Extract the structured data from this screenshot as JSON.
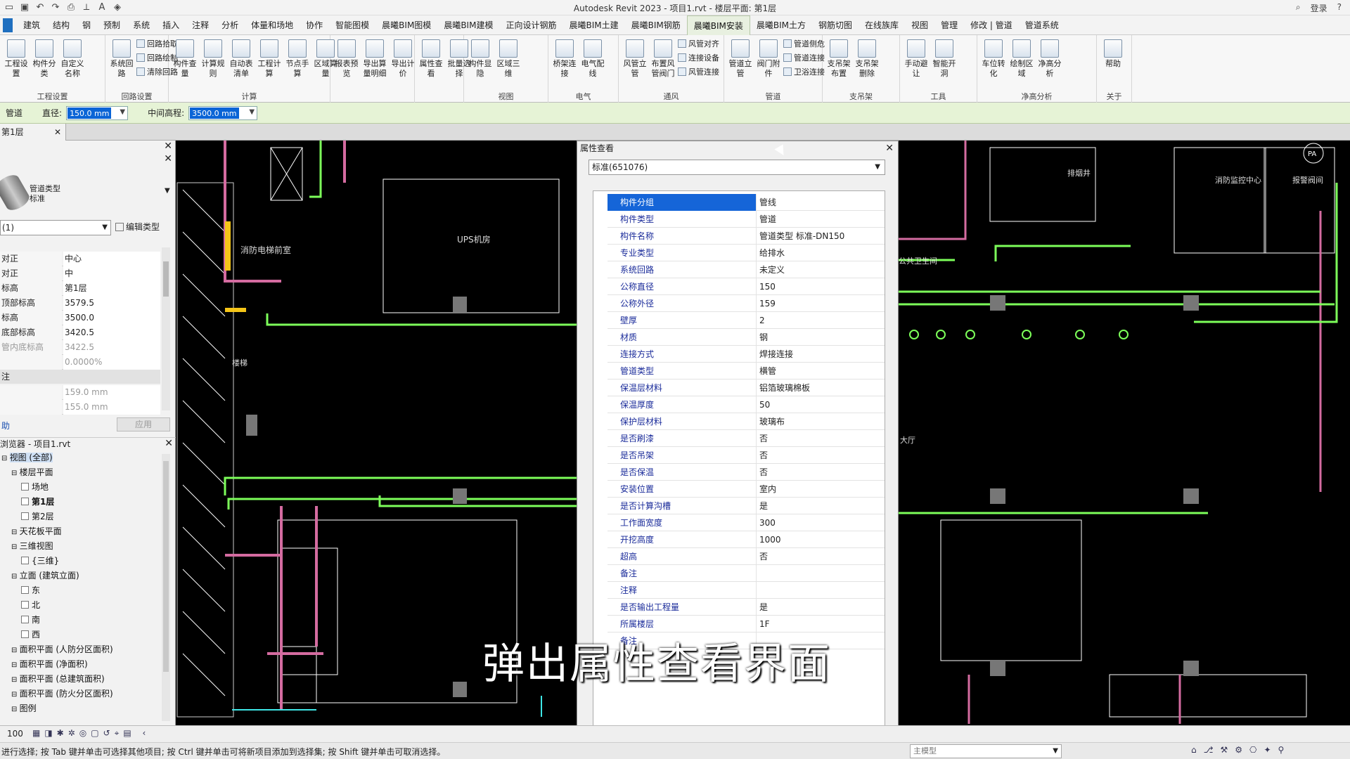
{
  "title": "Autodesk Revit 2023 - 项目1.rvt - 楼层平面: 第1层",
  "user": "登录",
  "tabs": [
    "建筑",
    "结构",
    "钢",
    "预制",
    "系统",
    "插入",
    "注释",
    "分析",
    "体量和场地",
    "协作",
    "智能图模",
    "晨曦BIM图模",
    "晨曦BIM建模",
    "正向设计钢筋",
    "晨曦BIM土建",
    "晨曦BIM钢筋",
    "晨曦BIM安装",
    "晨曦BIM土方",
    "钢筋切图",
    "在线族库",
    "视图",
    "管理",
    "修改 | 管道",
    "管道系统"
  ],
  "active_tab": "晨曦BIM安装",
  "ribbon": {
    "groups": [
      {
        "label": "工程设置",
        "buttons": [
          "工程设置",
          "构件分类",
          "自定义名称"
        ]
      },
      {
        "label": "回路设置",
        "buttons": [
          "系统回路"
        ],
        "small": [
          "回路拾取",
          "回路绘制",
          "清除回路"
        ]
      },
      {
        "label": "计算",
        "buttons": [
          "构件查量",
          "计算规则",
          "自动表清单",
          "工程计算",
          "节点手算",
          "区域算量"
        ]
      },
      {
        "label": "",
        "buttons": [
          "报表预览",
          "导出算量明细",
          "导出计价"
        ]
      },
      {
        "label": "",
        "buttons": [
          "属性查看",
          "批量选择"
        ]
      },
      {
        "label": "视图",
        "buttons": [
          "构件显隐",
          "区域三维"
        ]
      },
      {
        "label": "电气",
        "buttons": [
          "桥架连接",
          "电气配线"
        ]
      },
      {
        "label": "通风",
        "buttons": [
          "风管立管",
          "布置风管阀门"
        ],
        "small": [
          "风管对齐",
          "连接设备",
          "风管连接"
        ]
      },
      {
        "label": "管道",
        "buttons": [
          "管道立管",
          "阀门附件"
        ],
        "small": [
          "管道侧危",
          "管道连接",
          "卫浴连接"
        ]
      },
      {
        "label": "支吊架",
        "buttons": [
          "支吊架布置",
          "支吊架删除"
        ]
      },
      {
        "label": "工具",
        "buttons": [
          "手动避让",
          "智能开洞"
        ]
      },
      {
        "label": "净高分析",
        "buttons": [
          "车位转化",
          "绘制区域",
          "净高分析"
        ]
      },
      {
        "label": "关于",
        "buttons": [
          "帮助"
        ]
      }
    ]
  },
  "options_bar": {
    "label0": "管道",
    "diameter_label": "直径:",
    "diameter_value": "150.0 mm",
    "offset_label": "中间高程:",
    "offset_value": "3500.0 mm"
  },
  "view_tab": "第1层",
  "properties_panel": {
    "type_name_line1": "管道类型",
    "type_name_line2": "标准",
    "selector": "(1)",
    "edit_type": "编辑类型",
    "rows": [
      {
        "k": "对正",
        "v": "中心"
      },
      {
        "k": "对正",
        "v": "中"
      },
      {
        "k": "标高",
        "v": "第1层"
      },
      {
        "k": "顶部标高",
        "v": "3579.5"
      },
      {
        "k": "标高",
        "v": "3500.0"
      },
      {
        "k": "底部标高",
        "v": "3420.5"
      },
      {
        "k": "管内底标高",
        "v": "3422.5"
      },
      {
        "k": "",
        "v": "0.0000%"
      }
    ],
    "section2": "注",
    "rows2": [
      {
        "k": "",
        "v": "159.0 mm"
      },
      {
        "k": "",
        "v": "155.0 mm"
      }
    ],
    "help_link": "助",
    "apply": "应用"
  },
  "project_browser": {
    "title": "浏览器 - 项目1.rvt",
    "items": [
      {
        "t": "视图 (全部)",
        "lvl": 0
      },
      {
        "t": "楼层平面",
        "lvl": 1
      },
      {
        "t": "场地",
        "lvl": 2
      },
      {
        "t": "第1层",
        "lvl": 2
      },
      {
        "t": "第2层",
        "lvl": 2
      },
      {
        "t": "天花板平面",
        "lvl": 1
      },
      {
        "t": "三维视图",
        "lvl": 1
      },
      {
        "t": "{三维}",
        "lvl": 2
      },
      {
        "t": "立面 (建筑立面)",
        "lvl": 1
      },
      {
        "t": "东",
        "lvl": 2
      },
      {
        "t": "北",
        "lvl": 2
      },
      {
        "t": "南",
        "lvl": 2
      },
      {
        "t": "西",
        "lvl": 2
      },
      {
        "t": "面积平面 (人防分区面积)",
        "lvl": 1
      },
      {
        "t": "面积平面 (净面积)",
        "lvl": 1
      },
      {
        "t": "面积平面 (总建筑面积)",
        "lvl": 1
      },
      {
        "t": "面积平面 (防火分区面积)",
        "lvl": 1
      },
      {
        "t": "图例",
        "lvl": 1
      }
    ]
  },
  "dialog": {
    "title": "属性查看",
    "selector": "标准(651076)",
    "rows": [
      {
        "k": "构件分组",
        "v": "管线"
      },
      {
        "k": "构件类型",
        "v": "管道"
      },
      {
        "k": "构件名称",
        "v": "管道类型 标准-DN150"
      },
      {
        "k": "专业类型",
        "v": "给排水"
      },
      {
        "k": "系统回路",
        "v": "未定义"
      },
      {
        "k": "公称直径",
        "v": "150"
      },
      {
        "k": "公称外径",
        "v": "159"
      },
      {
        "k": "壁厚",
        "v": "2"
      },
      {
        "k": "材质",
        "v": "钢"
      },
      {
        "k": "连接方式",
        "v": "焊接连接"
      },
      {
        "k": "管道类型",
        "v": "横管"
      },
      {
        "k": "保温层材料",
        "v": "铝箔玻璃棉板"
      },
      {
        "k": "保温厚度",
        "v": "50"
      },
      {
        "k": "保护层材料",
        "v": "玻璃布"
      },
      {
        "k": "是否刷漆",
        "v": "否"
      },
      {
        "k": "是否吊架",
        "v": "否"
      },
      {
        "k": "是否保温",
        "v": "否"
      },
      {
        "k": "安装位置",
        "v": "室内"
      },
      {
        "k": "是否计算沟槽",
        "v": "是"
      },
      {
        "k": "工作面宽度",
        "v": "300"
      },
      {
        "k": "开挖高度",
        "v": "1000"
      },
      {
        "k": "超高",
        "v": "否"
      },
      {
        "k": "备注",
        "v": ""
      },
      {
        "k": "注释",
        "v": ""
      },
      {
        "k": "是否输出工程量",
        "v": "是"
      },
      {
        "k": "所属楼层",
        "v": "1F"
      },
      {
        "k": "备注",
        "v": ""
      }
    ]
  },
  "canvas_labels": {
    "room1": "消防电梯前室",
    "room2": "UPS机房",
    "room3": "楼梯",
    "r_room1": "排烟井",
    "r_room2": "消防监控中心",
    "r_room3": "报警阀间",
    "r_room4": "公共卫生间",
    "r_room5": "大厅",
    "north": "PA"
  },
  "subtitle": "弹出属性查看界面",
  "status_left": "100",
  "status_text": "进行选择; 按 Tab 键并单击可选择其他项目; 按 Ctrl 键并单击可将新项目添加到选择集; 按 Shift 键并单击可取消选择。",
  "status_model": "主模型",
  "colors": {
    "active_sel": "#1565d8",
    "pipe": "#7dff5a",
    "wall": "#d46ba0",
    "accent": "#0a64d6"
  }
}
